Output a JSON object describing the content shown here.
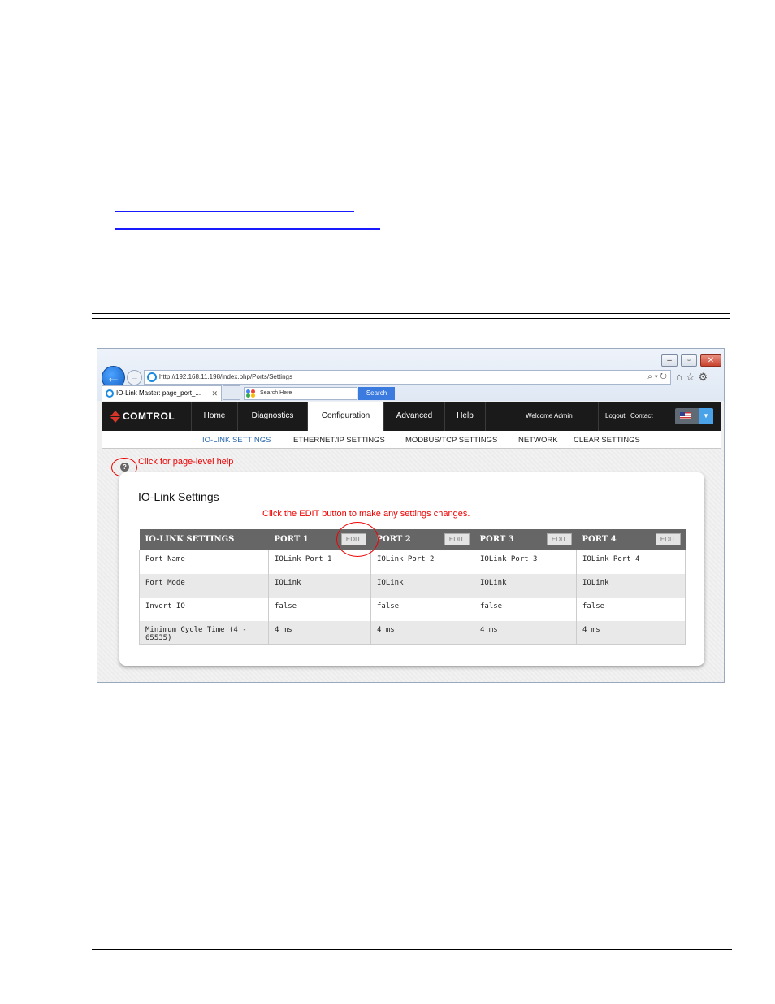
{
  "browser": {
    "url": "http://192.168.11.198/index.php/Ports/Settings",
    "tab_title": "IO-Link Master: page_port_...",
    "search_placeholder": "Search Here",
    "search_button": "Search"
  },
  "nav": {
    "brand": "COMTROL",
    "items": [
      "Home",
      "Diagnostics",
      "Configuration",
      "Advanced",
      "Help"
    ],
    "active": "Configuration",
    "welcome": "Welcome Admin",
    "logout": "Logout",
    "contact": "Contact"
  },
  "subnav": {
    "items": [
      "IO-LINK SETTINGS",
      "ETHERNET/IP SETTINGS",
      "MODBUS/TCP SETTINGS",
      "NETWORK",
      "CLEAR SETTINGS"
    ]
  },
  "annotations": {
    "help": "Click for page-level help",
    "edit": "Click the EDIT button to make any settings changes."
  },
  "panel": {
    "title": "IO-Link Settings",
    "table": {
      "header": "IO-LINK SETTINGS",
      "ports": [
        "PORT 1",
        "PORT 2",
        "PORT 3",
        "PORT 4"
      ],
      "edit_label": "EDIT",
      "rows": [
        {
          "label": "Port Name",
          "values": [
            "IOLink Port 1",
            "IOLink Port 2",
            "IOLink Port 3",
            "IOLink Port 4"
          ]
        },
        {
          "label": "Port Mode",
          "values": [
            "IOLink",
            "IOLink",
            "IOLink",
            "IOLink"
          ]
        },
        {
          "label": "Invert IO",
          "values": [
            "false",
            "false",
            "false",
            "false"
          ]
        },
        {
          "label": "Minimum Cycle Time (4 - 65535)",
          "values": [
            "4 ms",
            "4 ms",
            "4 ms",
            "4 ms"
          ]
        }
      ]
    }
  }
}
